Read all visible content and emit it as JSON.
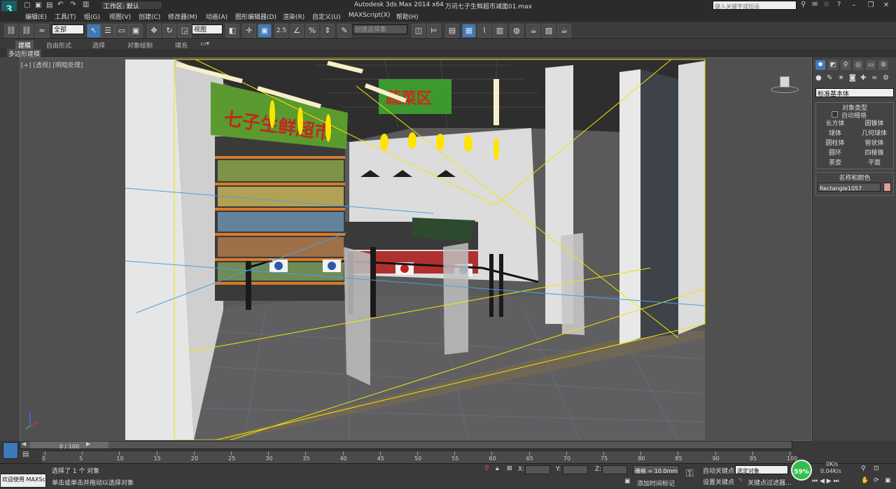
{
  "title_bar": {
    "workspace_label": "工作区: 默认",
    "app_title": "Autodesk 3ds Max  2014 x64",
    "file_name": "万讯七子生鲜超市减面01.max",
    "search_placeholder": "键入关键字或短语"
  },
  "menu": [
    "编辑(E)",
    "工具(T)",
    "组(G)",
    "视图(V)",
    "创建(C)",
    "修改器(M)",
    "动画(A)",
    "图形编辑器(D)",
    "渲染(R)",
    "自定义(U)",
    "MAXScript(X)",
    "帮助(H)"
  ],
  "toolbar": {
    "selection_filter": "全部",
    "reference_coord": "视图",
    "snap_label": "2.5",
    "named_selection": "创建选择集"
  },
  "ribbon": {
    "tabs": [
      "建模",
      "自由形式",
      "选择",
      "对象绘制",
      "填充"
    ],
    "sub_label": "多边形建模"
  },
  "viewport": {
    "label": "[+] [透视] [明暗处理]",
    "signs": {
      "right_sign_text": "蔬菜区",
      "left_sign_text": "七子生鲜超市"
    }
  },
  "command_panel": {
    "dropdown": "标准基本体",
    "section_object_type": "对象类型",
    "autogrid": "自动栅格",
    "buttons": [
      "长方体",
      "圆锥体",
      "球体",
      "几何球体",
      "圆柱体",
      "管状体",
      "圆环",
      "四棱锥",
      "茶壶",
      "平面"
    ],
    "section_name_color": "名称和颜色",
    "object_name": "Rectangle1057",
    "object_color": "#e29a9a"
  },
  "timeline": {
    "frame_display": "0 / 100",
    "ticks": [
      "0",
      "5",
      "10",
      "15",
      "20",
      "25",
      "30",
      "35",
      "40",
      "45",
      "50",
      "55",
      "60",
      "65",
      "70",
      "75",
      "80",
      "85",
      "90",
      "95",
      "100"
    ]
  },
  "status": {
    "welcome": "欢迎使用 MAXSc",
    "selected_text": "选择了 1 个 对象",
    "prompt_text": "单击或单击并拖动以选择对象",
    "x_label": "X:",
    "y_label": "Y:",
    "z_label": "Z:",
    "grid_text": "栅格 = 10.0mm",
    "add_time_tag": "添加时间标记",
    "auto_key": "自动关键点",
    "set_key": "设置关键点",
    "key_select": "选定对象",
    "key_filter": "关键点过滤器...",
    "cpu_percent": "59%",
    "net_up": "0K/s",
    "net_down": "0.04K/s"
  }
}
